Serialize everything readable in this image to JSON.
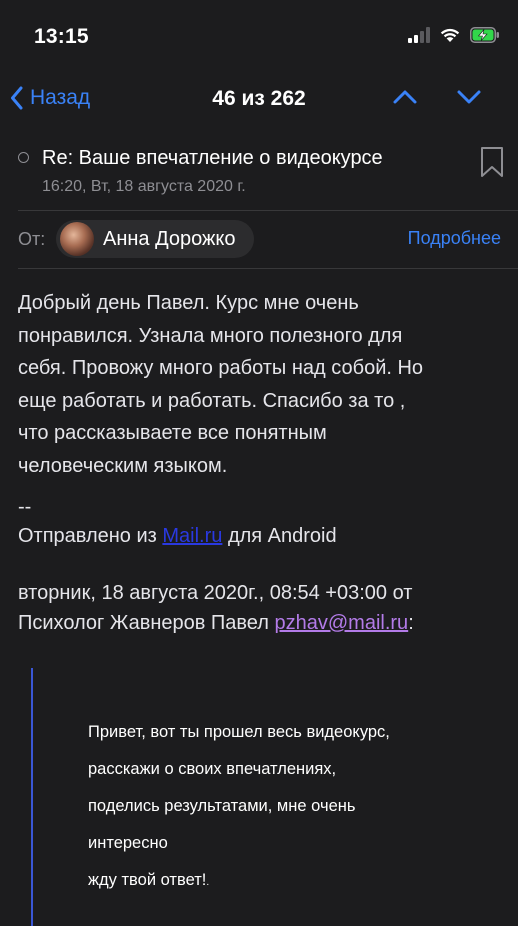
{
  "status": {
    "time": "13:15",
    "icons": [
      "cellular-signal-icon",
      "wifi-icon",
      "battery-charging-icon"
    ]
  },
  "nav": {
    "back_label": "Назад",
    "counter": "46 из 262",
    "icons": [
      "chevron-left-icon",
      "chevron-up-icon",
      "chevron-down-icon"
    ]
  },
  "message": {
    "subject": "Re: Ваше впечатление о видеокурсе",
    "date": "16:20, Вт, 18 августа 2020 г.",
    "from_label": "От:",
    "sender_name": "Анна Дорожко",
    "details_label": "Подробнее",
    "body_lines": [
      "Добрый день Павел. Курс мне очень",
      "понравился. Узнала много полезного для",
      "себя. Провожу много работы над собой. Но",
      "еще работать и работать. Спасибо за то ,",
      "что рассказываете все понятным",
      "человеческим языком."
    ],
    "signature_sep": "--",
    "signature_prefix": "Отправлено из ",
    "signature_link": "Mail.ru",
    "signature_suffix": " для Android",
    "quote_header_line1": "вторник, 18 августа 2020г., 08:54 +03:00 от",
    "quote_header_line2_prefix": "Психолог Жавнеров Павел ",
    "quote_email": "pzhav@mail.ru",
    "quote_header_line2_suffix": ":",
    "quote_lines": [
      "Привет, вот ты прошел весь видеокурс,",
      "расскажи о своих впечатлениях,",
      "поделись результатами, мне очень",
      "интересно",
      "жду твой ответ!"
    ],
    "quote_trailing_mark": "."
  },
  "colors": {
    "background": "#1c1c1e",
    "accent": "#3a82f7",
    "link_blue": "#2a39e0",
    "link_visited": "#b37be8",
    "quote_bar": "#3a57d6"
  }
}
